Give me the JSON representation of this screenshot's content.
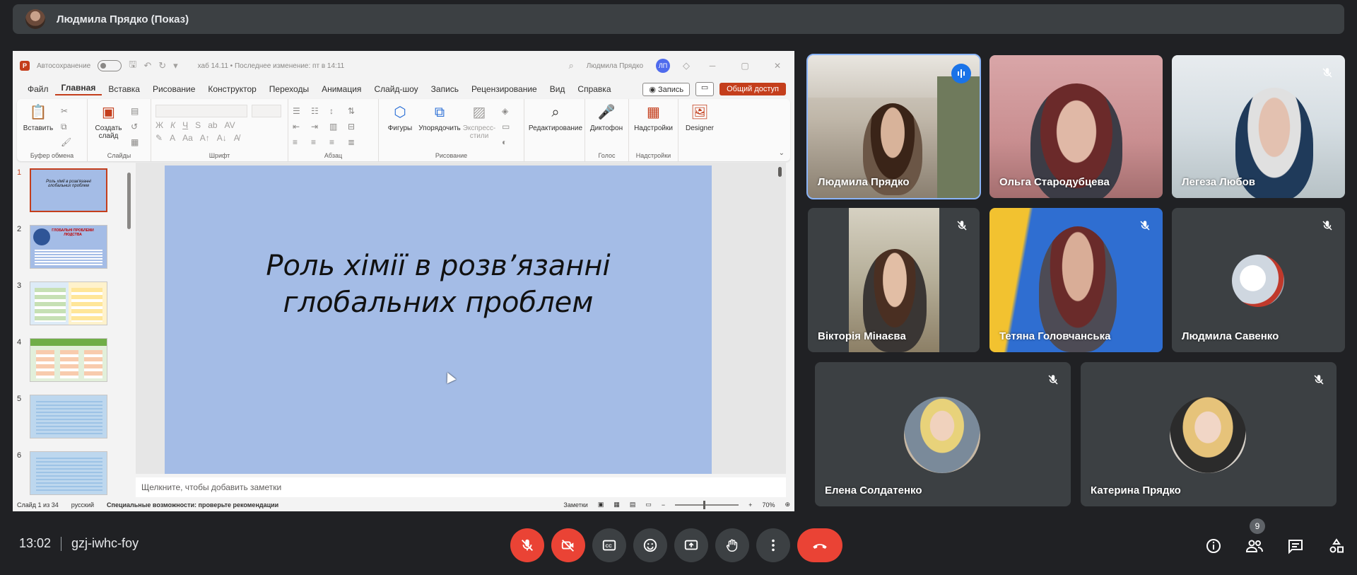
{
  "presenter_bar": {
    "title": "Людмила Прядко (Показ)"
  },
  "ppt": {
    "autosave_label": "Автосохранение",
    "doc_info": "хаб 14.11 • Последнее изменение: пт в 14:11",
    "user_name": "Людмила Прядко",
    "user_initials": "ЛП",
    "menu": [
      "Файл",
      "Главная",
      "Вставка",
      "Рисование",
      "Конструктор",
      "Переходы",
      "Анимация",
      "Слайд-шоу",
      "Запись",
      "Рецензирование",
      "Вид",
      "Справка"
    ],
    "active_menu": "Главная",
    "record_label": "Запись",
    "share_label": "Общий доступ",
    "ribbon": {
      "paste": "Вставить",
      "clipboard_group": "Буфер обмена",
      "new_slide": "Создать слайд",
      "slides_group": "Слайды",
      "font_group": "Шрифт",
      "paragraph_group": "Абзац",
      "shapes": "Фигуры",
      "arrange": "Упорядочить",
      "quick_styles": "Экспресс-стили",
      "drawing_group": "Рисование",
      "editing": "Редактирование",
      "dictate": "Диктофон",
      "voice_group": "Голос",
      "addins": "Надстройки",
      "addins_group": "Надстройки",
      "designer": "Designer"
    },
    "thumbnails": [
      {
        "num": "1",
        "title": "Роль хімії в розв'язанні глобальних проблем"
      },
      {
        "num": "2",
        "title": "ГЛОБАЛЬНІ ПРОБЛЕМИ ЛЮДСТВА"
      },
      {
        "num": "3",
        "title": ""
      },
      {
        "num": "4",
        "title": ""
      },
      {
        "num": "5",
        "title": ""
      },
      {
        "num": "6",
        "title": ""
      }
    ],
    "slide_title_line1": "Роль хімії в розв’язанні",
    "slide_title_line2": "глобальних проблем",
    "notes_placeholder": "Щелкните, чтобы добавить заметки",
    "status": {
      "slide_counter": "Слайд 1 из 34",
      "language": "русский",
      "accessibility": "Специальные возможности: проверьте рекомендации",
      "notes": "Заметки",
      "zoom": "70%"
    }
  },
  "participants": [
    {
      "name": "Людмила Прядко",
      "speaking": true,
      "muted": false
    },
    {
      "name": "Ольга Стародубцева",
      "speaking": false,
      "muted": false
    },
    {
      "name": "Легеза Любов",
      "speaking": false,
      "muted": true
    },
    {
      "name": "Вікторія Мінаєва",
      "speaking": false,
      "muted": true
    },
    {
      "name": "Тетяна Головчанська",
      "speaking": false,
      "muted": true
    },
    {
      "name": "Людмила Савенко",
      "speaking": false,
      "muted": true
    },
    {
      "name": "Елена Солдатенко",
      "speaking": false,
      "muted": true
    },
    {
      "name": "Катерина Прядко",
      "speaking": false,
      "muted": true
    }
  ],
  "meeting": {
    "time": "13:02",
    "code": "gzj-iwhc-foy",
    "participant_count": "9"
  },
  "colors": {
    "background": "#202124",
    "tile": "#3c4043",
    "danger": "#ea4335",
    "speaking": "#1a73e8",
    "ppt_accent": "#c43e1c",
    "slide_bg": "#a4bce6"
  }
}
